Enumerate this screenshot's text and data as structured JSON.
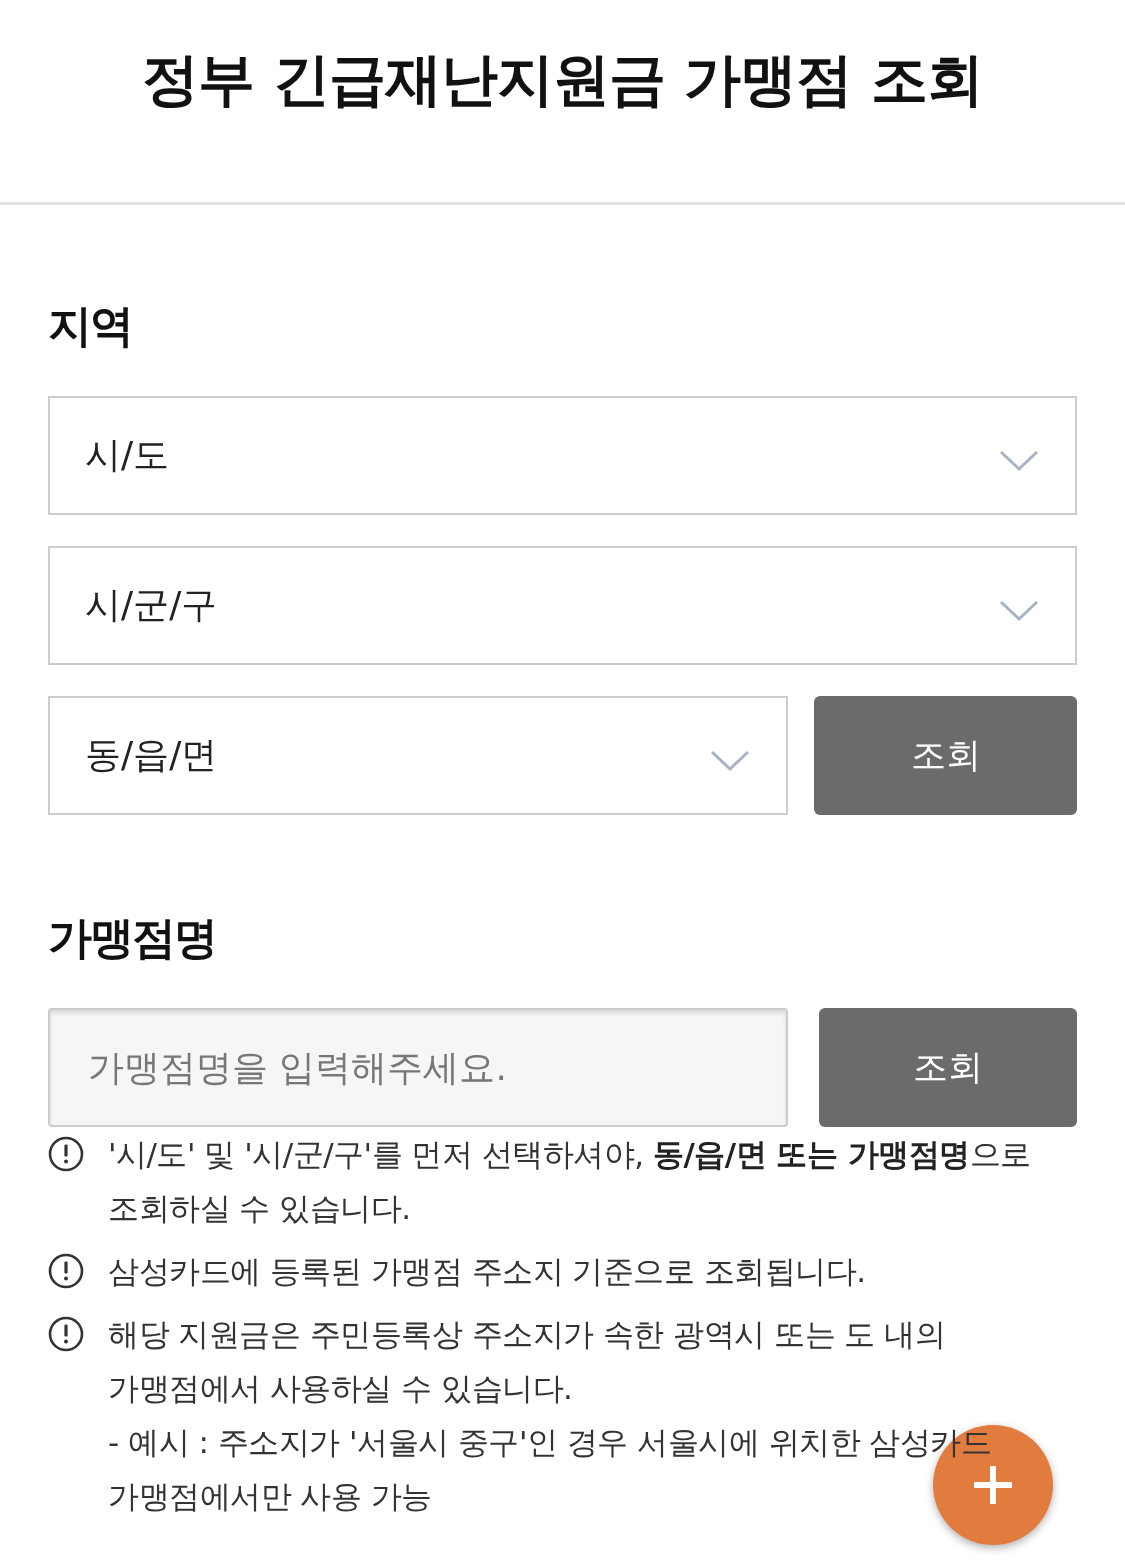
{
  "header": {
    "title": "정부 긴급재난지원금 가맹점 조회"
  },
  "region": {
    "heading": "지역",
    "selects": [
      {
        "label": "시/도"
      },
      {
        "label": "시/군/구"
      },
      {
        "label": "동/읍/면"
      }
    ],
    "search_button": "조회"
  },
  "store_name": {
    "heading": "가맹점명",
    "input": {
      "placeholder": "가맹점명을 입력해주세요."
    },
    "search_button": "조회"
  },
  "notes": [
    {
      "text": "'시/도' 및 '시/군/구'를 먼저 선택하셔야, **동/읍/면 또는 가맹점명**으로 조회하실 수 있습니다."
    },
    {
      "text": "삼성카드에 등록된 가맹점 주소지 기준으로 조회됩니다."
    },
    {
      "text": "해당 지원금은 주민등록상 주소지가 속한 광역시 또는 도 내의 가맹점에서 사용하실 수 있습니다.",
      "example": "- 예시 : 주소지가 '서울시 중구'인 경우 서울시에 위치한 삼성카드 가맹점에서만 사용 가능"
    }
  ]
}
